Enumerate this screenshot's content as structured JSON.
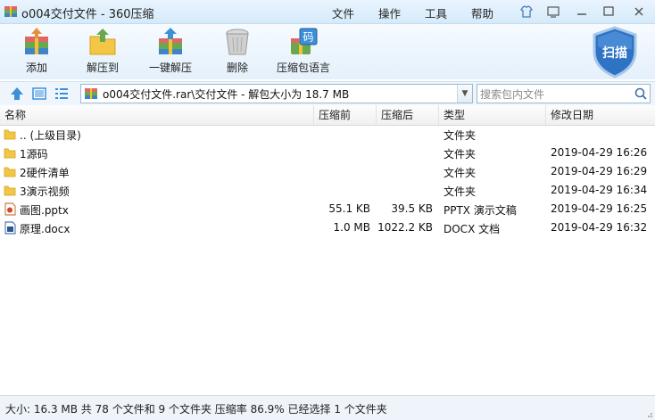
{
  "window": {
    "title": "o004交付文件 - 360压缩",
    "menu": [
      "文件",
      "操作",
      "工具",
      "帮助"
    ],
    "controls": [
      "shirt-icon",
      "menu-icon",
      "minimize-icon",
      "maximize-icon",
      "close-icon"
    ]
  },
  "toolbar": {
    "items": [
      {
        "label": "添加",
        "icon": "add-archive-icon"
      },
      {
        "label": "解压到",
        "icon": "extract-to-icon"
      },
      {
        "label": "一键解压",
        "icon": "one-click-extract-icon"
      },
      {
        "label": "删除",
        "icon": "delete-trash-icon"
      },
      {
        "label": "压缩包语言",
        "icon": "archive-language-icon",
        "badge": "码"
      }
    ],
    "scan_label": "扫描"
  },
  "address": {
    "path": "o004交付文件.rar\\交付文件 - 解包大小为 18.7 MB",
    "search_placeholder": "搜索包内文件"
  },
  "columns": [
    "名称",
    "压缩前",
    "压缩后",
    "类型",
    "修改日期"
  ],
  "files": [
    {
      "name": ".. (上级目录)",
      "before": "",
      "after": "",
      "type": "文件夹",
      "date": "",
      "icon": "folder-icon"
    },
    {
      "name": "1源码",
      "before": "",
      "after": "",
      "type": "文件夹",
      "date": "2019-04-29 16:26",
      "icon": "folder-icon"
    },
    {
      "name": "2硬件清单",
      "before": "",
      "after": "",
      "type": "文件夹",
      "date": "2019-04-29 16:29",
      "icon": "folder-icon"
    },
    {
      "name": "3演示视频",
      "before": "",
      "after": "",
      "type": "文件夹",
      "date": "2019-04-29 16:34",
      "icon": "folder-icon"
    },
    {
      "name": "画图.pptx",
      "before": "55.1 KB",
      "after": "39.5 KB",
      "type": "PPTX 演示文稿",
      "date": "2019-04-29 16:25",
      "icon": "pptx-file-icon"
    },
    {
      "name": "原理.docx",
      "before": "1.0 MB",
      "after": "1022.2 KB",
      "type": "DOCX 文档",
      "date": "2019-04-29 16:32",
      "icon": "docx-file-icon"
    }
  ],
  "status": "大小: 16.3 MB 共 78 个文件和 9 个文件夹 压缩率 86.9% 已经选择 1 个文件夹",
  "colors": {
    "accent": "#3c8fd8",
    "folder": "#f3c646",
    "scan_shield": "#2f74c4"
  }
}
